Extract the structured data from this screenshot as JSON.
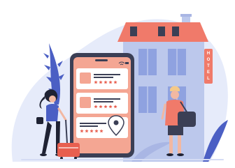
{
  "hotel_sign": {
    "letters": [
      "H",
      "O",
      "T",
      "E",
      "L"
    ]
  },
  "phone_app": {
    "listings": [
      {
        "rating_stars": 5
      },
      {
        "rating_stars": 5
      },
      {
        "rating_stars": 5
      }
    ]
  },
  "colors": {
    "background_blob": "#e6ebfa",
    "building": "#bcc8ec",
    "roof": "#f07a6a",
    "phone_frame": "#3b3f55",
    "phone_screen": "#f4a693",
    "card": "#ffffff",
    "star": "#e85f4f",
    "suitcase": "#e85f4f",
    "foliage": "#4b5fc4"
  },
  "icons": [
    "wifi-icon",
    "battery-icon",
    "location-pin-icon",
    "image-placeholder-icon",
    "star-icon"
  ]
}
